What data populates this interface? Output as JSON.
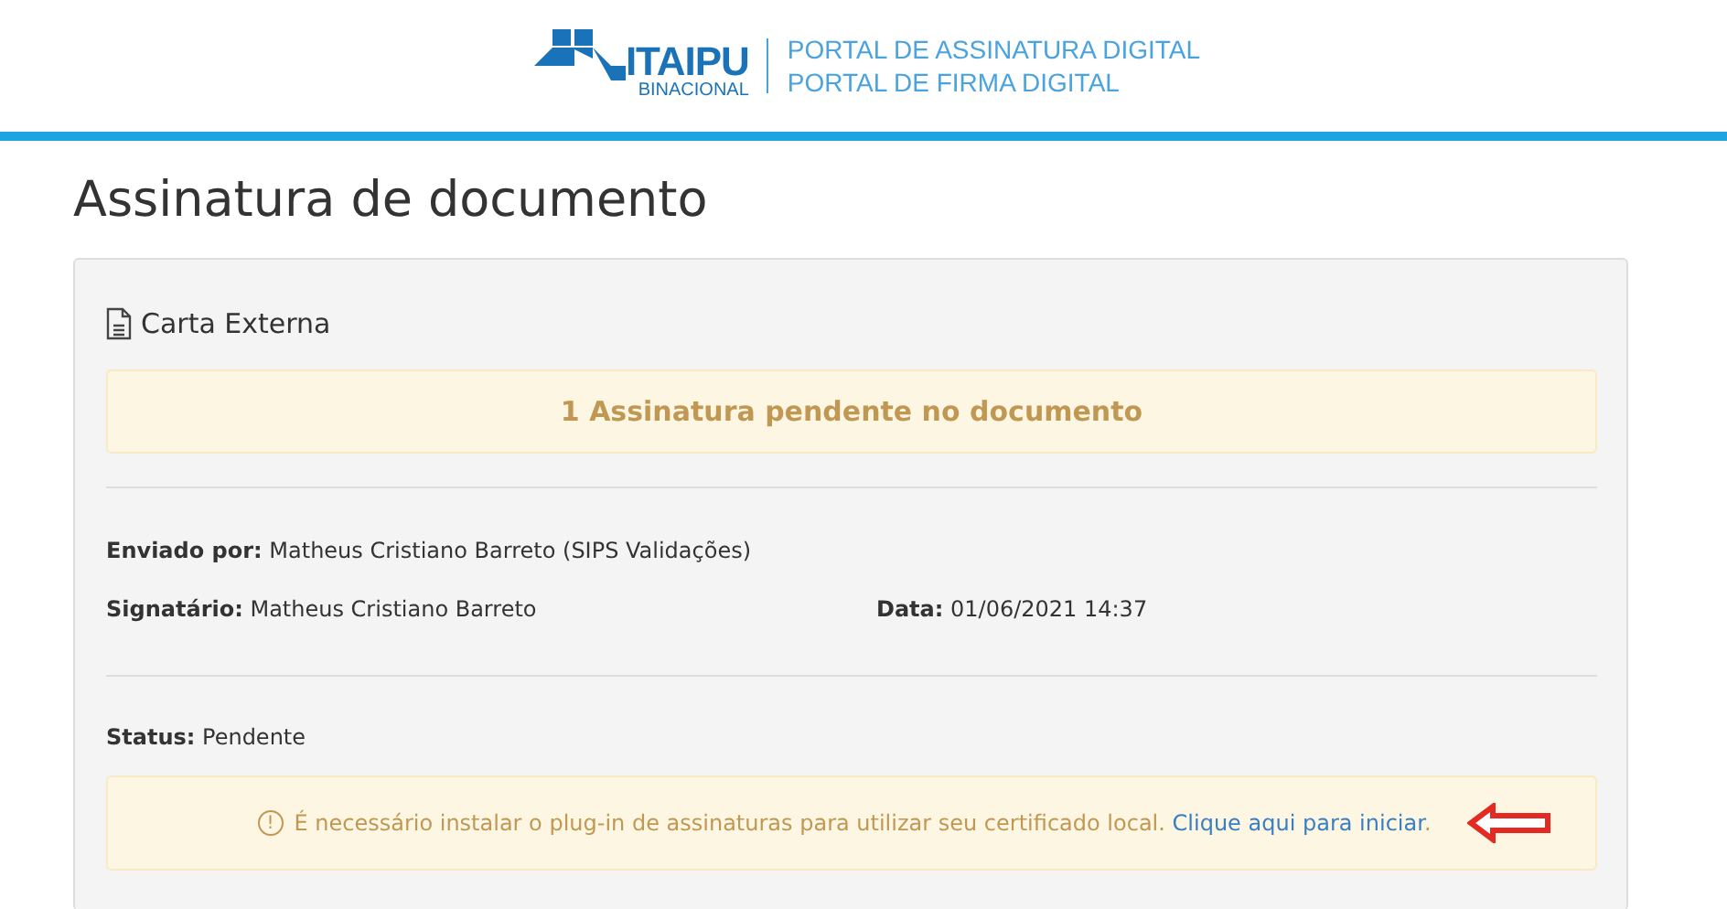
{
  "header": {
    "logo_name": "ITAIPU",
    "logo_subtitle": "BINACIONAL",
    "portal_lines": [
      "PORTAL DE ASSINATURA DIGITAL",
      "PORTAL DE FIRMA DIGITAL"
    ]
  },
  "page_title": "Assinatura de documento",
  "document": {
    "name": "Carta Externa"
  },
  "pending_alert": "1 Assinatura pendente no documento",
  "details": [
    {
      "text": "**Enviado por:** Matheus Cristiano Barreto (SIPS Validações)"
    },
    {
      "text": "**Signatário:** Matheus Cristiano Barreto"
    },
    {
      "text": "**Data:** 01/06/2021 14:37"
    }
  ],
  "status": "**Status:** Pendente",
  "plugin_notice": {
    "icon": "!",
    "message": "É necessário instalar o plug-in de assinaturas para utilizar seu certificado local.",
    "link": "Clique aqui para iniciar",
    "after_link": "."
  }
}
